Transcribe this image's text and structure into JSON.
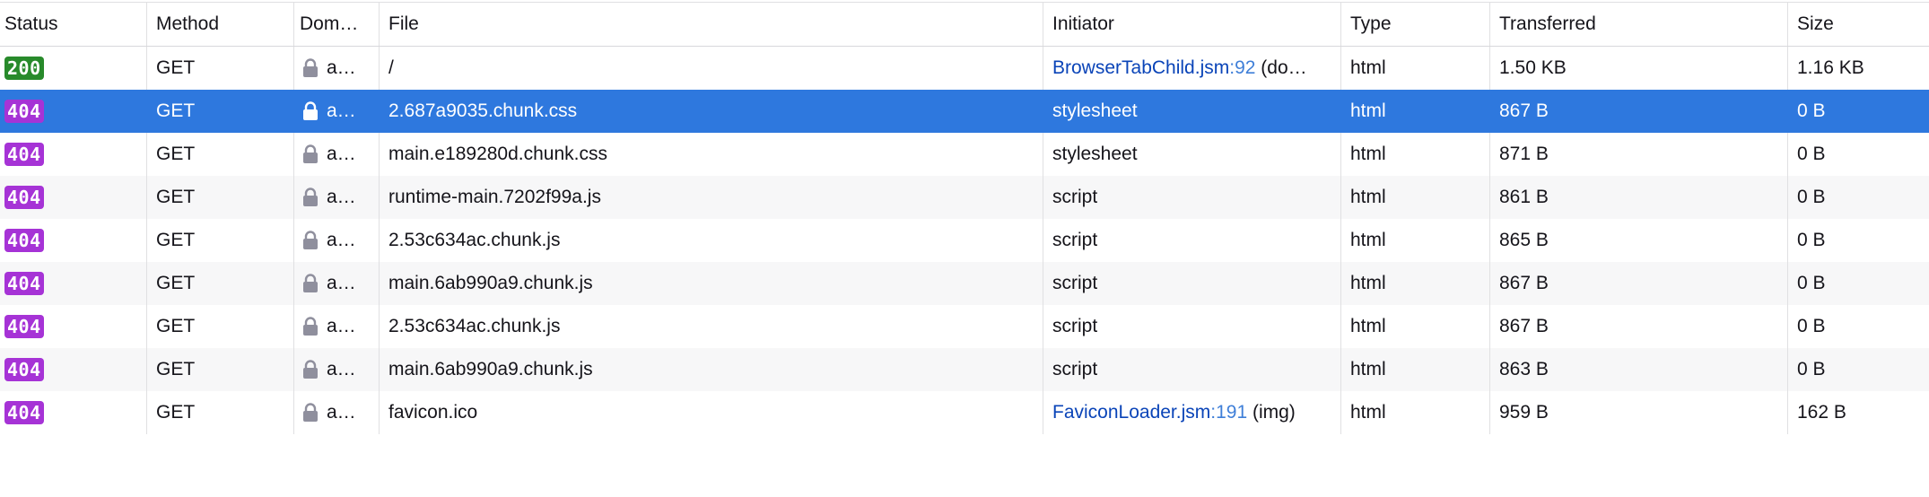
{
  "columns": {
    "status": "Status",
    "method": "Method",
    "domain": "Dom…",
    "file": "File",
    "initiator": "Initiator",
    "type": "Type",
    "transferred": "Transferred",
    "size": "Size"
  },
  "colors": {
    "status_ok": "#288a2b",
    "status_error": "#a633d6",
    "selected_row": "#2e78de",
    "link": "#0a44b8"
  },
  "rows": [
    {
      "status": "200",
      "method": "GET",
      "domain": "a…",
      "file": "/",
      "initiator": "BrowserTabChild.jsm:92 (do…",
      "initiator_file": "BrowserTabChild.jsm",
      "initiator_line": ":92",
      "initiator_suffix": " (do…",
      "type": "html",
      "transferred": "1.50 KB",
      "size": "1.16 KB"
    },
    {
      "status": "404",
      "method": "GET",
      "domain": "a…",
      "file": "2.687a9035.chunk.css",
      "initiator": "stylesheet",
      "type": "html",
      "transferred": "867 B",
      "size": "0 B"
    },
    {
      "status": "404",
      "method": "GET",
      "domain": "a…",
      "file": "main.e189280d.chunk.css",
      "initiator": "stylesheet",
      "type": "html",
      "transferred": "871 B",
      "size": "0 B"
    },
    {
      "status": "404",
      "method": "GET",
      "domain": "a…",
      "file": "runtime-main.7202f99a.js",
      "initiator": "script",
      "type": "html",
      "transferred": "861 B",
      "size": "0 B"
    },
    {
      "status": "404",
      "method": "GET",
      "domain": "a…",
      "file": "2.53c634ac.chunk.js",
      "initiator": "script",
      "type": "html",
      "transferred": "865 B",
      "size": "0 B"
    },
    {
      "status": "404",
      "method": "GET",
      "domain": "a…",
      "file": "main.6ab990a9.chunk.js",
      "initiator": "script",
      "type": "html",
      "transferred": "867 B",
      "size": "0 B"
    },
    {
      "status": "404",
      "method": "GET",
      "domain": "a…",
      "file": "2.53c634ac.chunk.js",
      "initiator": "script",
      "type": "html",
      "transferred": "867 B",
      "size": "0 B"
    },
    {
      "status": "404",
      "method": "GET",
      "domain": "a…",
      "file": "main.6ab990a9.chunk.js",
      "initiator": "script",
      "type": "html",
      "transferred": "863 B",
      "size": "0 B"
    },
    {
      "status": "404",
      "method": "GET",
      "domain": "a…",
      "file": "favicon.ico",
      "initiator": "FaviconLoader.jsm:191 (img)",
      "initiator_file": "FaviconLoader.jsm",
      "initiator_line": ":191",
      "initiator_suffix": " (img)",
      "type": "html",
      "transferred": "959 B",
      "size": "162 B"
    }
  ]
}
